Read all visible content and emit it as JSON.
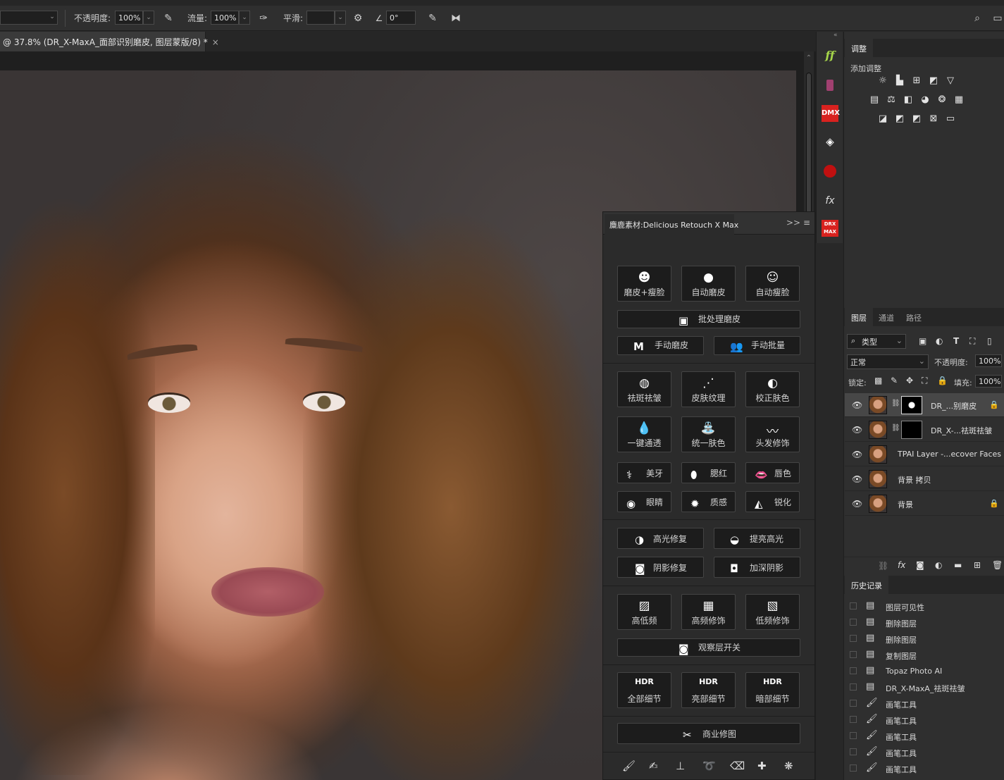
{
  "options_bar": {
    "opacity_label": "不透明度:",
    "opacity_value": "100%",
    "flow_label": "流量:",
    "flow_value": "100%",
    "smooth_label": "平滑:",
    "smooth_value": "",
    "angle_value": "0°"
  },
  "document_tab": {
    "title": "@ 37.8% (DR_X-MaxA_面部识别磨皮, 图层蒙版/8) *",
    "close": "×"
  },
  "plugin": {
    "title": "麋鹿素材:Delicious Retouch X Max",
    "collapse": ">>",
    "menu": "≡",
    "grid_top": [
      {
        "label": "磨皮+瘦脸",
        "icon": "face-retouch-icon"
      },
      {
        "label": "自动磨皮",
        "icon": "auto-smooth-icon"
      },
      {
        "label": "自动瘦脸",
        "icon": "auto-slim-icon"
      }
    ],
    "batch": "批处理磨皮",
    "manual_smooth": "手动磨皮",
    "manual_batch": "手动批量",
    "grid_mid": [
      {
        "label": "祛斑祛皱"
      },
      {
        "label": "皮肤纹理"
      },
      {
        "label": "校正肤色"
      },
      {
        "label": "一键通透"
      },
      {
        "label": "统一肤色"
      },
      {
        "label": "头发修饰"
      }
    ],
    "small_row1": [
      "美牙",
      "腮红",
      "唇色"
    ],
    "small_row2": [
      "眼睛",
      "质感",
      "锐化"
    ],
    "tone_row1": [
      "高光修复",
      "提亮高光"
    ],
    "tone_row2": [
      "阴影修复",
      "加深阴影"
    ],
    "freq": [
      "高低频",
      "高频修饰",
      "低频修饰"
    ],
    "observe": "观察层开关",
    "detail": [
      "全部细节",
      "亮部细节",
      "暗部细节"
    ],
    "commercial": "商业修图"
  },
  "icon_strip": [
    "ff",
    "DMX"
  ],
  "adjustments": {
    "tab": "调整",
    "add_label": "添加调整"
  },
  "layers_panel": {
    "tabs": [
      "图层",
      "通道",
      "路径"
    ],
    "filter_kind": "类型",
    "blend_mode": "正常",
    "opacity_label": "不透明度:",
    "opacity_value": "100%",
    "lock_label": "锁定:",
    "fill_label": "填充:",
    "fill_value": "100%",
    "layers": [
      {
        "name": "DR_...别磨皮",
        "locked": true,
        "selected": true,
        "mask": true
      },
      {
        "name": "DR_X-...祛斑祛皱",
        "locked": false,
        "selected": false,
        "mask": true
      },
      {
        "name": "TPAI Layer -...ecover Faces",
        "locked": false,
        "selected": false,
        "mask": false
      },
      {
        "name": "背景 拷贝",
        "locked": false,
        "selected": false,
        "mask": false
      },
      {
        "name": "背景",
        "locked": true,
        "selected": false,
        "mask": false
      }
    ]
  },
  "history_panel": {
    "tab": "历史记录",
    "items": [
      "图层可见性",
      "删除图层",
      "删除图层",
      "复制图层",
      "Topaz Photo AI",
      "DR_X-MaxA_祛斑祛皱",
      "画笔工具",
      "画笔工具",
      "画笔工具",
      "画笔工具",
      "画笔工具"
    ]
  }
}
